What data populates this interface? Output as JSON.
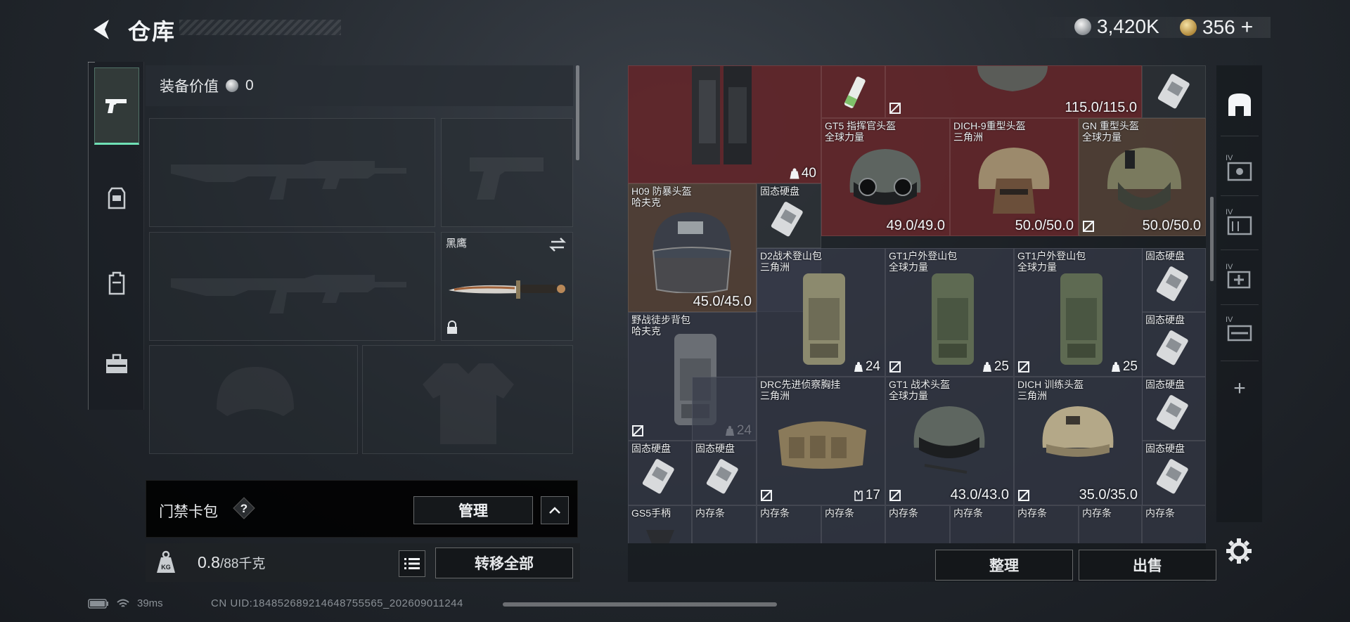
{
  "header": {
    "title": "仓库",
    "silver_amount": "3,420K",
    "gold_amount": "356",
    "add_symbol": "+"
  },
  "side_tabs": [
    {
      "name": "weapons",
      "icon": "pistol-icon"
    },
    {
      "name": "armor",
      "icon": "chest-rig-icon"
    },
    {
      "name": "backpack",
      "icon": "backpack-icon"
    },
    {
      "name": "supplies",
      "icon": "medkit-icon"
    }
  ],
  "loadout": {
    "equip_value_label": "装备价值",
    "equip_value": "0",
    "melee_label": "黑鹰"
  },
  "keycard": {
    "title": "门禁卡包",
    "help": "?",
    "manage": "管理"
  },
  "weight": {
    "current": "0.8",
    "max": "/88千克",
    "transfer_all": "转移全部"
  },
  "storage": {
    "items": [
      {
        "id": "vest-top",
        "name": "",
        "sub": "",
        "count": "40"
      },
      {
        "id": "stick",
        "name": "",
        "sub": ""
      },
      {
        "id": "helmet-top",
        "name": "",
        "sub": "",
        "dur": "115.0/115.0"
      },
      {
        "id": "ssd-top",
        "name": "",
        "sub": ""
      },
      {
        "id": "gt5",
        "name": "GT5 指挥官头盔",
        "sub": "全球力量",
        "dur": "49.0/49.0"
      },
      {
        "id": "dich9",
        "name": "DICH-9重型头盔",
        "sub": "三角洲",
        "dur": "50.0/50.0"
      },
      {
        "id": "gn",
        "name": "GN 重型头盔",
        "sub": "全球力量",
        "dur": "50.0/50.0"
      },
      {
        "id": "h09",
        "name": "H09 防暴头盔",
        "sub": "哈夫克",
        "dur": "45.0/45.0"
      },
      {
        "id": "ssd1",
        "name": "固态硬盘",
        "sub": ""
      },
      {
        "id": "d2",
        "name": "D2战术登山包",
        "sub": "三角洲",
        "count": "24"
      },
      {
        "id": "gt1bag-a",
        "name": "GT1户外登山包",
        "sub": "全球力量",
        "count": "25"
      },
      {
        "id": "gt1bag-b",
        "name": "GT1户外登山包",
        "sub": "全球力量",
        "count": "25"
      },
      {
        "id": "ssd2",
        "name": "固态硬盘",
        "sub": ""
      },
      {
        "id": "field-pack",
        "name": "野战徒步背包",
        "sub": "哈夫克",
        "count": "24"
      },
      {
        "id": "ssd3",
        "name": "固态硬盘",
        "sub": ""
      },
      {
        "id": "drc",
        "name": "DRC先进侦察胸挂",
        "sub": "三角洲",
        "count": "17"
      },
      {
        "id": "gt1helm",
        "name": "GT1 战术头盔",
        "sub": "全球力量",
        "dur": "43.0/43.0"
      },
      {
        "id": "dichtrain",
        "name": "DICH 训练头盔",
        "sub": "三角洲",
        "dur": "35.0/35.0"
      },
      {
        "id": "ssd4",
        "name": "固态硬盘",
        "sub": ""
      },
      {
        "id": "ssd5",
        "name": "固态硬盘",
        "sub": ""
      },
      {
        "id": "ssd6",
        "name": "固态硬盘",
        "sub": ""
      },
      {
        "id": "ssd7",
        "name": "固态硬盘",
        "sub": ""
      },
      {
        "id": "gs5",
        "name": "GS5手柄",
        "sub": ""
      },
      {
        "id": "ram1",
        "name": "内存条",
        "sub": ""
      },
      {
        "id": "ram2",
        "name": "内存条",
        "sub": ""
      },
      {
        "id": "ram3",
        "name": "内存条",
        "sub": ""
      },
      {
        "id": "ram4",
        "name": "内存条",
        "sub": ""
      },
      {
        "id": "ram5",
        "name": "内存条",
        "sub": ""
      },
      {
        "id": "ram6",
        "name": "内存条",
        "sub": ""
      },
      {
        "id": "ram7",
        "name": "内存条",
        "sub": ""
      },
      {
        "id": "ram8",
        "name": "内存条",
        "sub": ""
      }
    ],
    "sort": "整理",
    "sell": "出售"
  },
  "right_rail": {
    "tiers": [
      "IV",
      "IV",
      "IV",
      "IV"
    ],
    "add": "+"
  },
  "status": {
    "ping": "39ms",
    "uid": "CN UID:18485268921464875556​5_20260901​1244"
  }
}
